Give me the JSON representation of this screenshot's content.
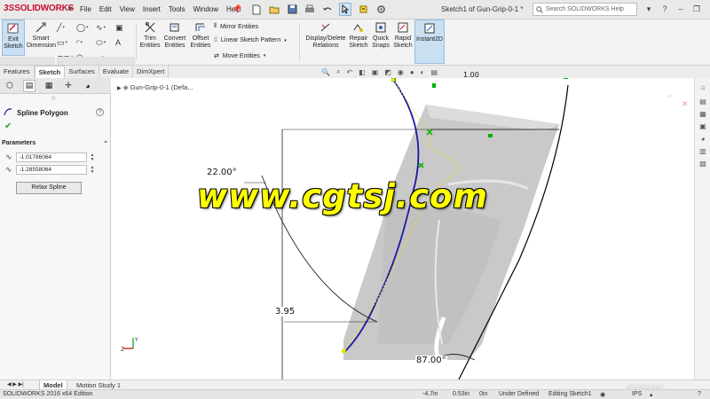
{
  "app": {
    "logo_text_ds": "3S",
    "logo_text_name": "SOLIDWORKS",
    "document_title": "Sketch1 of Gun-Grip-0-1 *",
    "search_placeholder": "Search SOLIDWORKS Help"
  },
  "menu": [
    "File",
    "Edit",
    "View",
    "Insert",
    "Tools",
    "Window",
    "Help"
  ],
  "commands": {
    "exit_sketch": [
      "Exit",
      "Sketch"
    ],
    "smart_dimension": [
      "Smart",
      "Dimension"
    ],
    "trim_entities": [
      "Trim",
      "Entities"
    ],
    "convert_entities": [
      "Convert",
      "Entities"
    ],
    "offset_entities": [
      "Offset",
      "Entities"
    ],
    "mirror_entities": "Mirror Entities",
    "linear_sketch_pattern": "Linear Sketch Pattern",
    "move_entities": "Move Entities",
    "display_delete_relations": [
      "Display/Delete",
      "Relations"
    ],
    "repair_sketch": [
      "Repair",
      "Sketch"
    ],
    "quick_snaps": [
      "Quick",
      "Snaps"
    ],
    "rapid_sketch": [
      "Rapid",
      "Sketch"
    ],
    "instant2d": "Instant2D"
  },
  "tabs": [
    "Features",
    "Sketch",
    "Surfaces",
    "Evaluate",
    "DimXpert"
  ],
  "active_tab": "Sketch",
  "feature_tree_item": "Gun-Grip-0-1  (Defa...",
  "property_manager": {
    "title": "Spline Polygon",
    "section": "Parameters",
    "param1": "-1.01786064",
    "param2": "-1.28558064",
    "relax_button": "Relax Spline"
  },
  "canvas": {
    "dim_angle_1": "22.00°",
    "dim_length": "3.95",
    "dim_angle_2": "87.00°",
    "dim_top_partial": "1.00",
    "watermark": "www.cgtsj.com"
  },
  "bottom_tabs": [
    "Model",
    "Motion Study 1"
  ],
  "status": {
    "edition": "SOLIDWORKS 2016 x64 Edition",
    "x": "-4.7in",
    "y": "0.53in",
    "z": "0in",
    "state": "Under Defined",
    "editing": "Editing Sketch1",
    "units": "IPS"
  },
  "overlay": "pluralsight",
  "colors": {
    "brand_red": "#c8102e",
    "spline_blue": "#1a1aa0",
    "polygon_yellow": "#e6e600",
    "point_green": "#00b000",
    "watermark_yellow": "#ffff00"
  }
}
